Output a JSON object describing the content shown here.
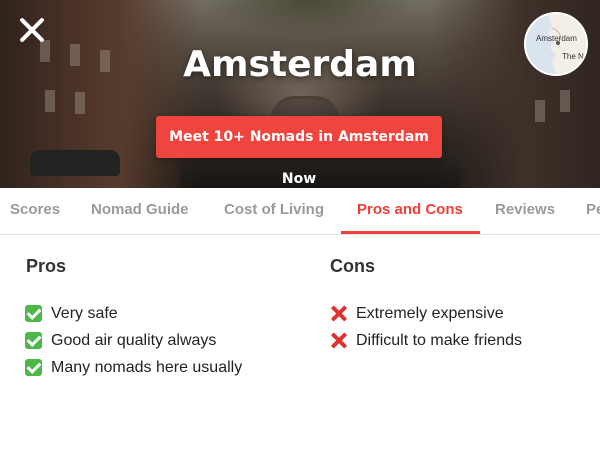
{
  "header": {
    "city": "Amsterdam",
    "cta_label": "Meet 10+ Nomads in Amsterdam Now",
    "map": {
      "city_label": "Amsterdam",
      "country_label": "The Netherl"
    }
  },
  "tabs": [
    {
      "label": "Scores",
      "active": false
    },
    {
      "label": "Nomad Guide",
      "active": false
    },
    {
      "label": "Cost of Living",
      "active": false
    },
    {
      "label": "Pros and Cons",
      "active": true
    },
    {
      "label": "Reviews",
      "active": false
    },
    {
      "label": "Pe",
      "active": false
    }
  ],
  "pros": {
    "title": "Pros",
    "items": [
      "Very safe",
      "Good air quality always",
      "Many nomads here usually"
    ]
  },
  "cons": {
    "title": "Cons",
    "items": [
      "Extremely expensive",
      "Difficult to make friends"
    ]
  },
  "colors": {
    "accent": "#ec4039",
    "cta": "#f0453f",
    "check": "#4cb84a",
    "cross": "#e0322d"
  }
}
